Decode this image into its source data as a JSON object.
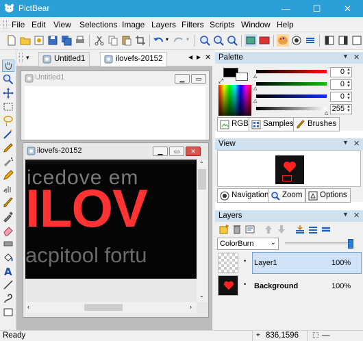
{
  "window": {
    "title": "PictBear",
    "controls": [
      "—",
      "☐",
      "✕"
    ]
  },
  "menu": [
    "File",
    "Edit",
    "View",
    "Selections",
    "Image",
    "Layers",
    "Filters",
    "Scripts",
    "Window",
    "Help"
  ],
  "document_tabs": [
    {
      "label": "Untitled1",
      "active": false
    },
    {
      "label": "ilovefs-20152",
      "active": true
    }
  ],
  "tab_nav": {
    "prev": "◀",
    "next": "▶",
    "close": "✕"
  },
  "windows": {
    "untitled": {
      "title": "Untitled1"
    },
    "ilovefs": {
      "title": "ilovefs-20152"
    }
  },
  "canvas_text": {
    "top_line": "icedove  em",
    "main": "ILOV",
    "bottom_line": "acpitool  fortu"
  },
  "palette": {
    "header": "Palette",
    "channels": [
      {
        "name": "red",
        "value": "0",
        "color": "#e02020"
      },
      {
        "name": "green",
        "value": "0",
        "color": "#20a020"
      },
      {
        "name": "blue",
        "value": "0",
        "color": "#2030d0"
      },
      {
        "name": "alpha",
        "value": "255",
        "color": "#808080"
      }
    ],
    "tabs": [
      {
        "label": "RGB",
        "icon": "rgb-icon",
        "active": true
      },
      {
        "label": "Samples",
        "icon": "samples-icon",
        "active": false
      },
      {
        "label": "Brushes",
        "icon": "brushes-icon",
        "active": false
      }
    ]
  },
  "view": {
    "header": "View",
    "tabs": [
      {
        "label": "Navigation",
        "icon": "navigation-icon",
        "active": true
      },
      {
        "label": "Zoom",
        "icon": "zoom-icon",
        "active": false
      },
      {
        "label": "Options",
        "icon": "options-icon",
        "active": false
      }
    ]
  },
  "layers": {
    "header": "Layers",
    "blend_mode": "ColorBurn",
    "opacity_level": 1.0,
    "items": [
      {
        "name": "Layer1",
        "opacity": "100%",
        "selected": true,
        "bold": false
      },
      {
        "name": "Background",
        "opacity": "100%",
        "selected": false,
        "bold": true
      }
    ]
  },
  "status": {
    "left": "Ready",
    "coords": "836,1596",
    "extra": "—"
  },
  "colors": {
    "titlebar": "#2b9fd8",
    "canvas_red": "#ff3333",
    "panel_header": "#cfe0ef",
    "selected_layer": "#cfe2f8"
  }
}
